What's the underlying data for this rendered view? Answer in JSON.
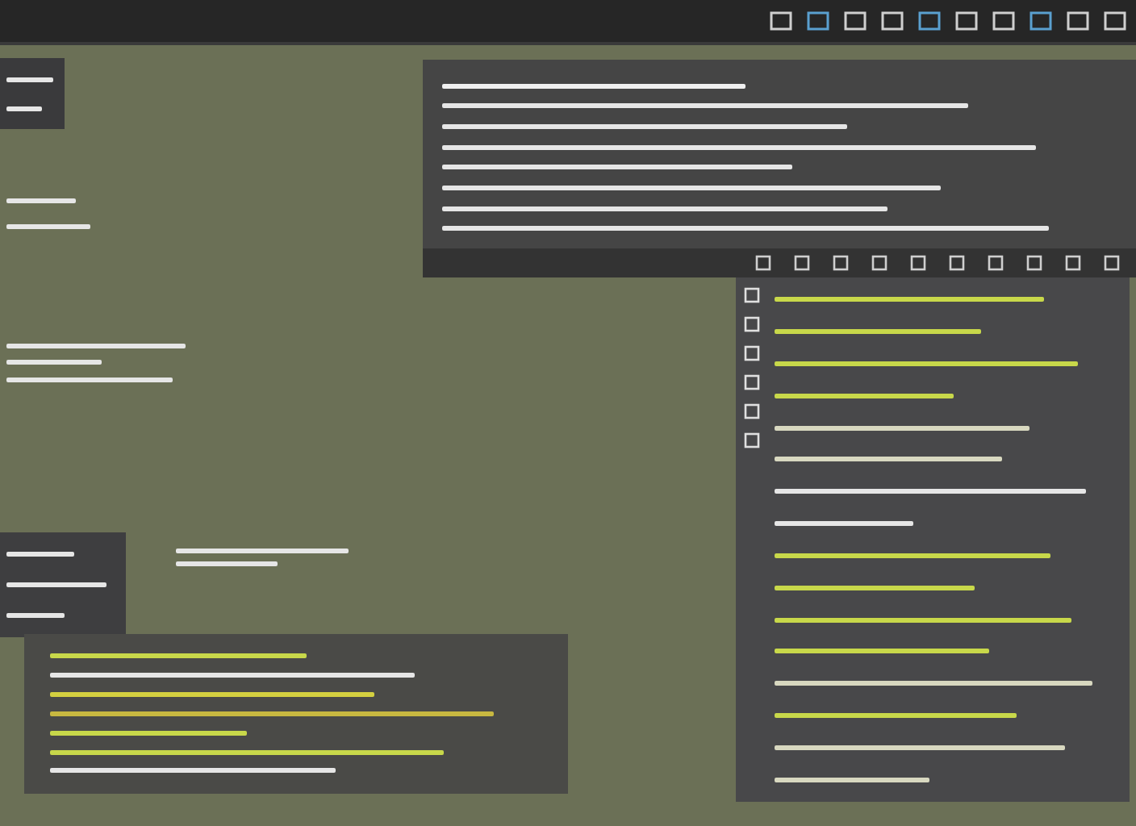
{
  "windows": [
    {
      "kind": "mini",
      "lines": [
        {
          "color": "#e6e6e6"
        },
        {
          "color": "#e6e6e6"
        }
      ]
    },
    {
      "kind": "loose",
      "lines": [
        {
          "color": "#e6e6e6"
        },
        {
          "color": "#e6e6e6"
        }
      ]
    },
    {
      "kind": "loose",
      "lines": [
        {
          "color": "#e6e6e6"
        },
        {
          "color": "#e6e6e6"
        },
        {
          "color": "#e6e6e6"
        }
      ]
    },
    {
      "kind": "editor",
      "lines": [
        {
          "color": "#f0f0f0"
        },
        {
          "color": "#e6e6e6"
        },
        {
          "color": "#e6e6e6"
        },
        {
          "color": "#e6e6e6"
        },
        {
          "color": "#e6e6e6"
        },
        {
          "color": "#e6e6e6"
        },
        {
          "color": "#e6e6e6"
        },
        {
          "color": "#e6e6e6"
        }
      ]
    },
    {
      "kind": "panel",
      "lines": [
        {
          "color": "#c8d84a"
        },
        {
          "color": "#c8d84a"
        },
        {
          "color": "#c8d84a"
        },
        {
          "color": "#c8d84a"
        },
        {
          "color": "#d8d8c0"
        },
        {
          "color": "#d8d8c0"
        },
        {
          "color": "#e6e6e6"
        },
        {
          "color": "#e6e6e6"
        },
        {
          "color": "#c8d84a"
        },
        {
          "color": "#c8d84a"
        },
        {
          "color": "#c8d84a"
        },
        {
          "color": "#c8d84a"
        },
        {
          "color": "#d8d8c0"
        },
        {
          "color": "#c8d84a"
        },
        {
          "color": "#d8d8c0"
        },
        {
          "color": "#d8d8c0"
        }
      ]
    },
    {
      "kind": "small",
      "lines": [
        {
          "color": "#e6e6e6"
        },
        {
          "color": "#e6e6e6"
        },
        {
          "color": "#e6e6e6"
        }
      ]
    },
    {
      "kind": "loose",
      "lines": [
        {
          "color": "#e6e6e6"
        },
        {
          "color": "#e6e6e6"
        }
      ]
    },
    {
      "kind": "info",
      "lines": [
        {
          "color": "#c8d84a"
        },
        {
          "color": "#e6e6e6"
        },
        {
          "color": "#d4d040"
        },
        {
          "color": "#c8b840"
        },
        {
          "color": "#c8d84a"
        },
        {
          "color": "#c8d84a"
        },
        {
          "color": "#e6e6e6"
        }
      ]
    }
  ]
}
